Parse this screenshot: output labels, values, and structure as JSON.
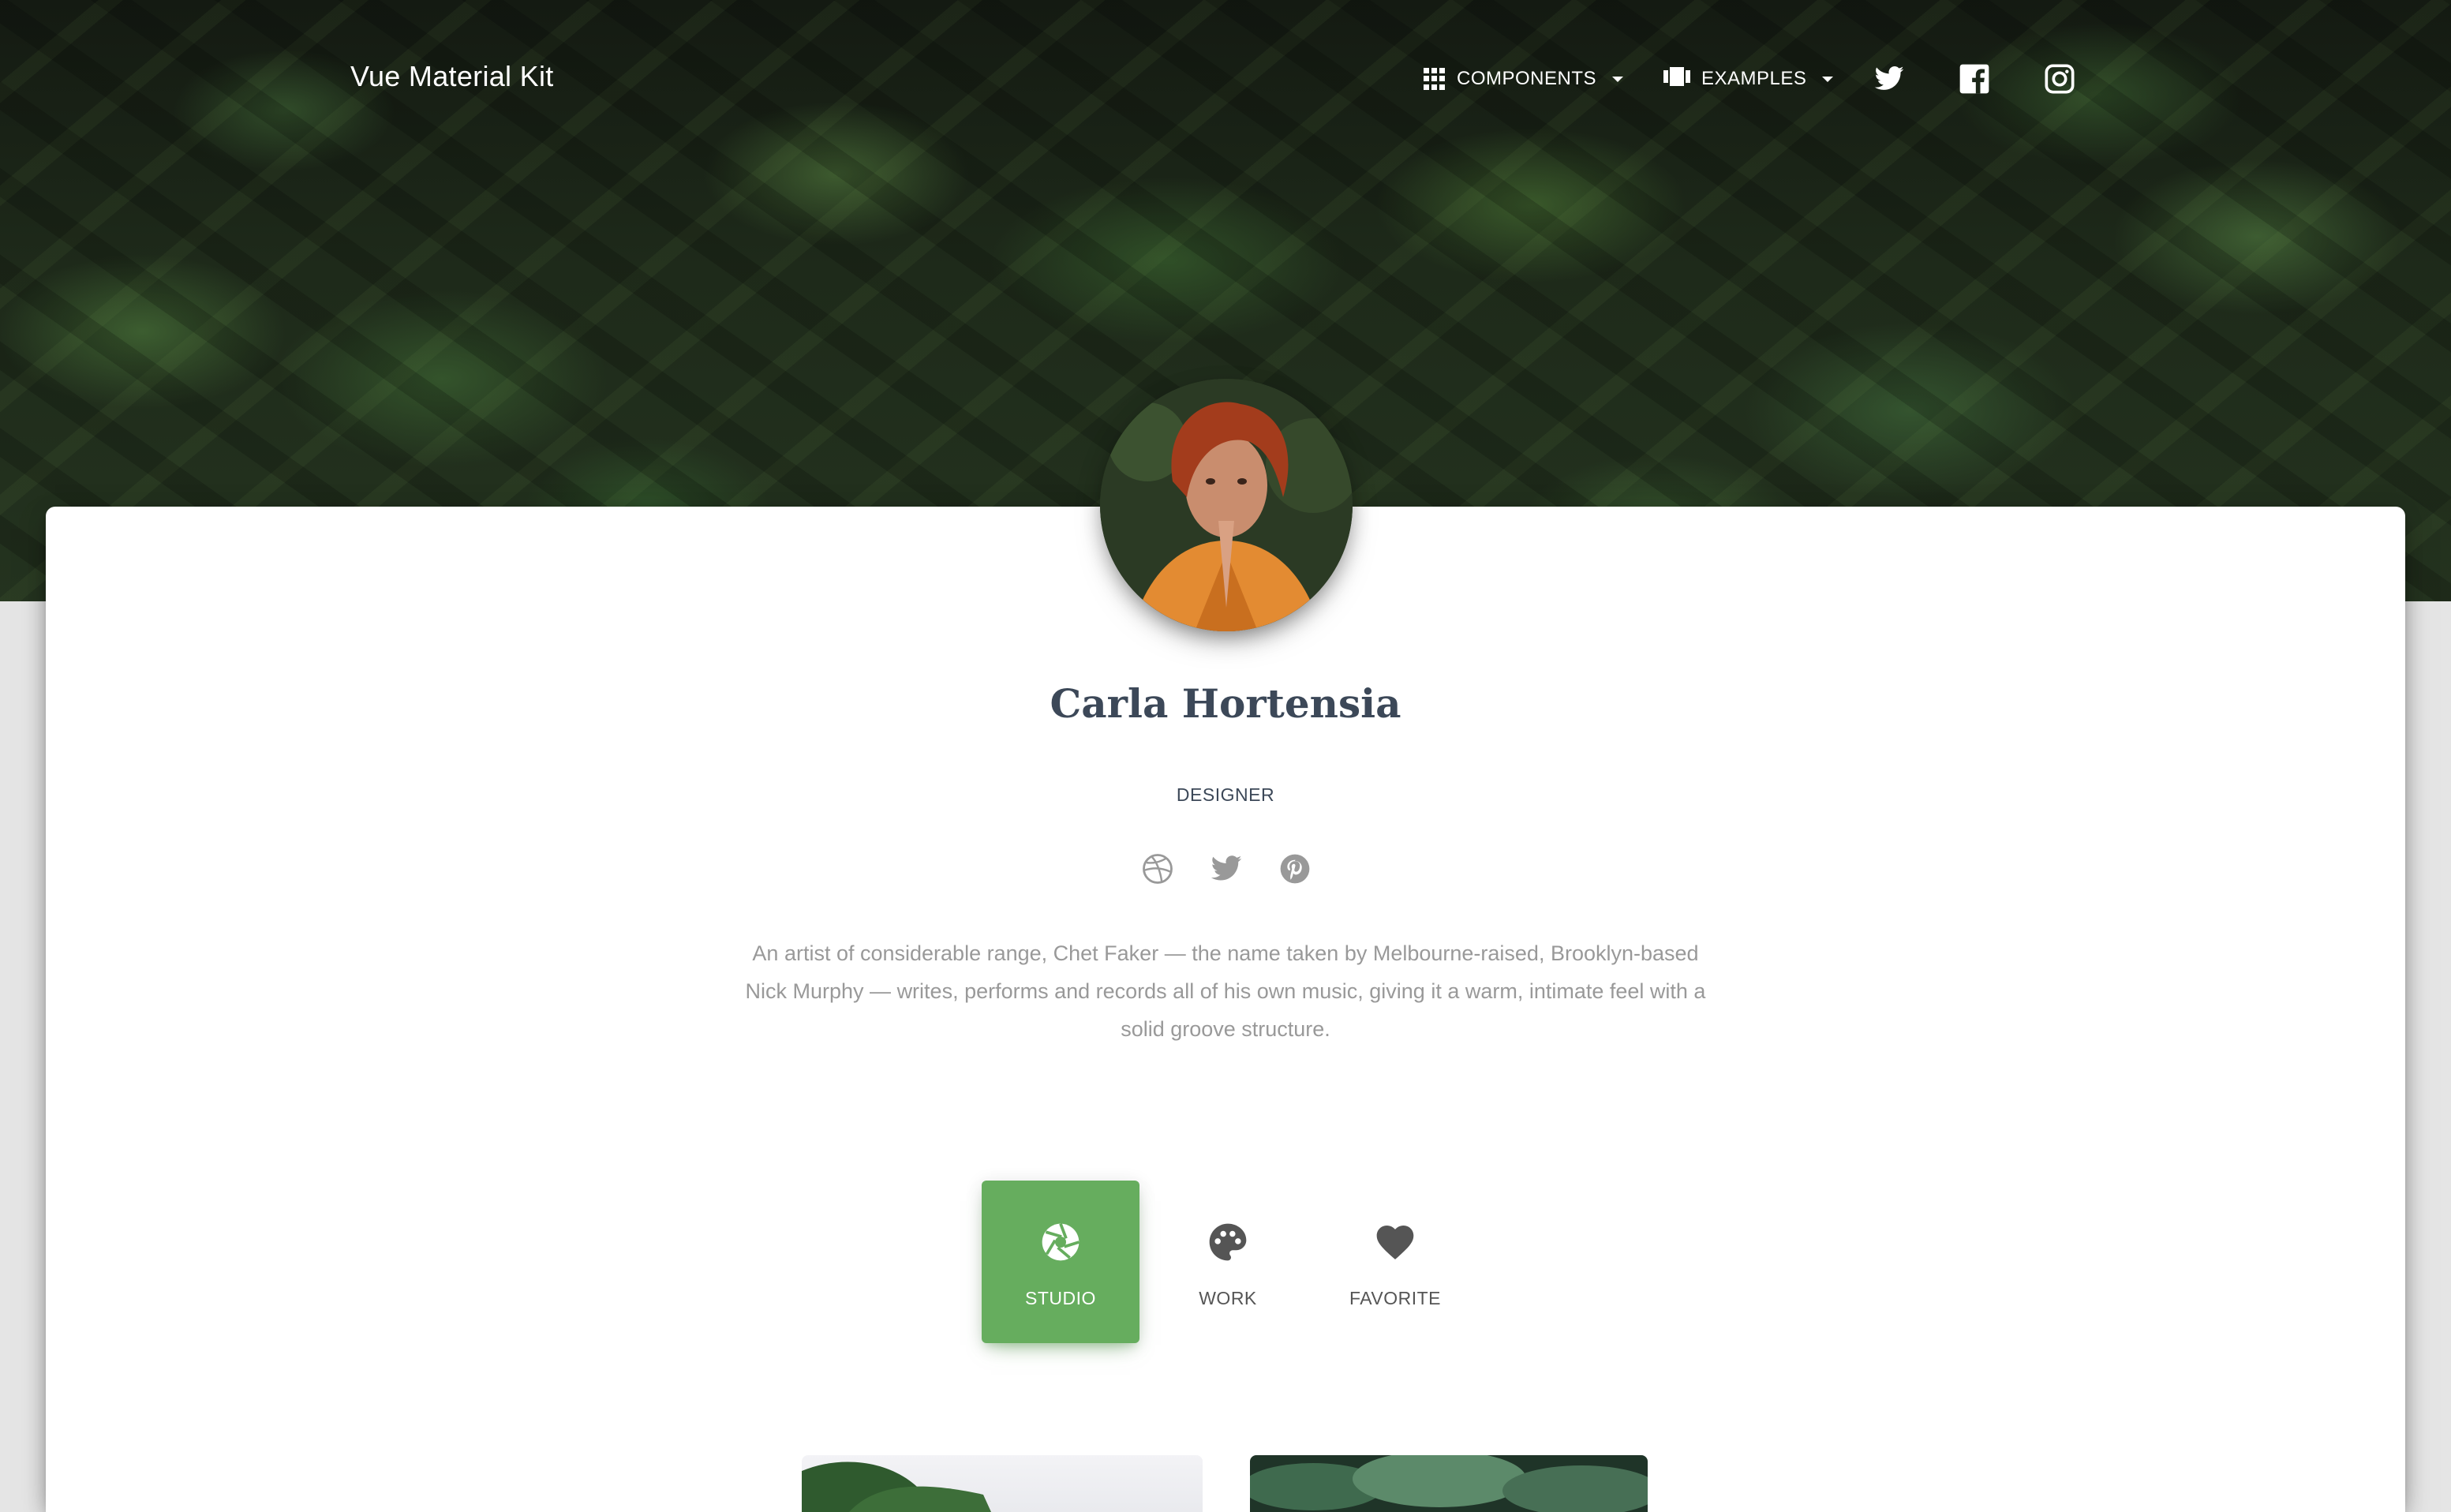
{
  "navbar": {
    "brand": "Vue Material Kit",
    "components_label": "COMPONENTS",
    "examples_label": "EXAMPLES",
    "social": [
      "twitter-icon",
      "facebook-icon",
      "instagram-icon"
    ]
  },
  "profile": {
    "name": "Carla Hortensia",
    "role": "DESIGNER",
    "social": [
      "dribbble-icon",
      "twitter-icon",
      "pinterest-icon"
    ],
    "bio": "An artist of considerable range, Chet Faker — the name taken by Melbourne-raised, Brooklyn-based Nick Murphy — writes, performs and records all of his own music, giving it a warm, intimate feel with a solid groove structure."
  },
  "tabs": [
    {
      "label": "STUDIO",
      "icon": "camera-shutter-icon",
      "active": true
    },
    {
      "label": "WORK",
      "icon": "palette-icon",
      "active": false
    },
    {
      "label": "FAVORITE",
      "icon": "heart-icon",
      "active": false
    }
  ],
  "colors": {
    "accent": "#66ad5e",
    "title": "#3c4858",
    "muted": "#999999"
  }
}
